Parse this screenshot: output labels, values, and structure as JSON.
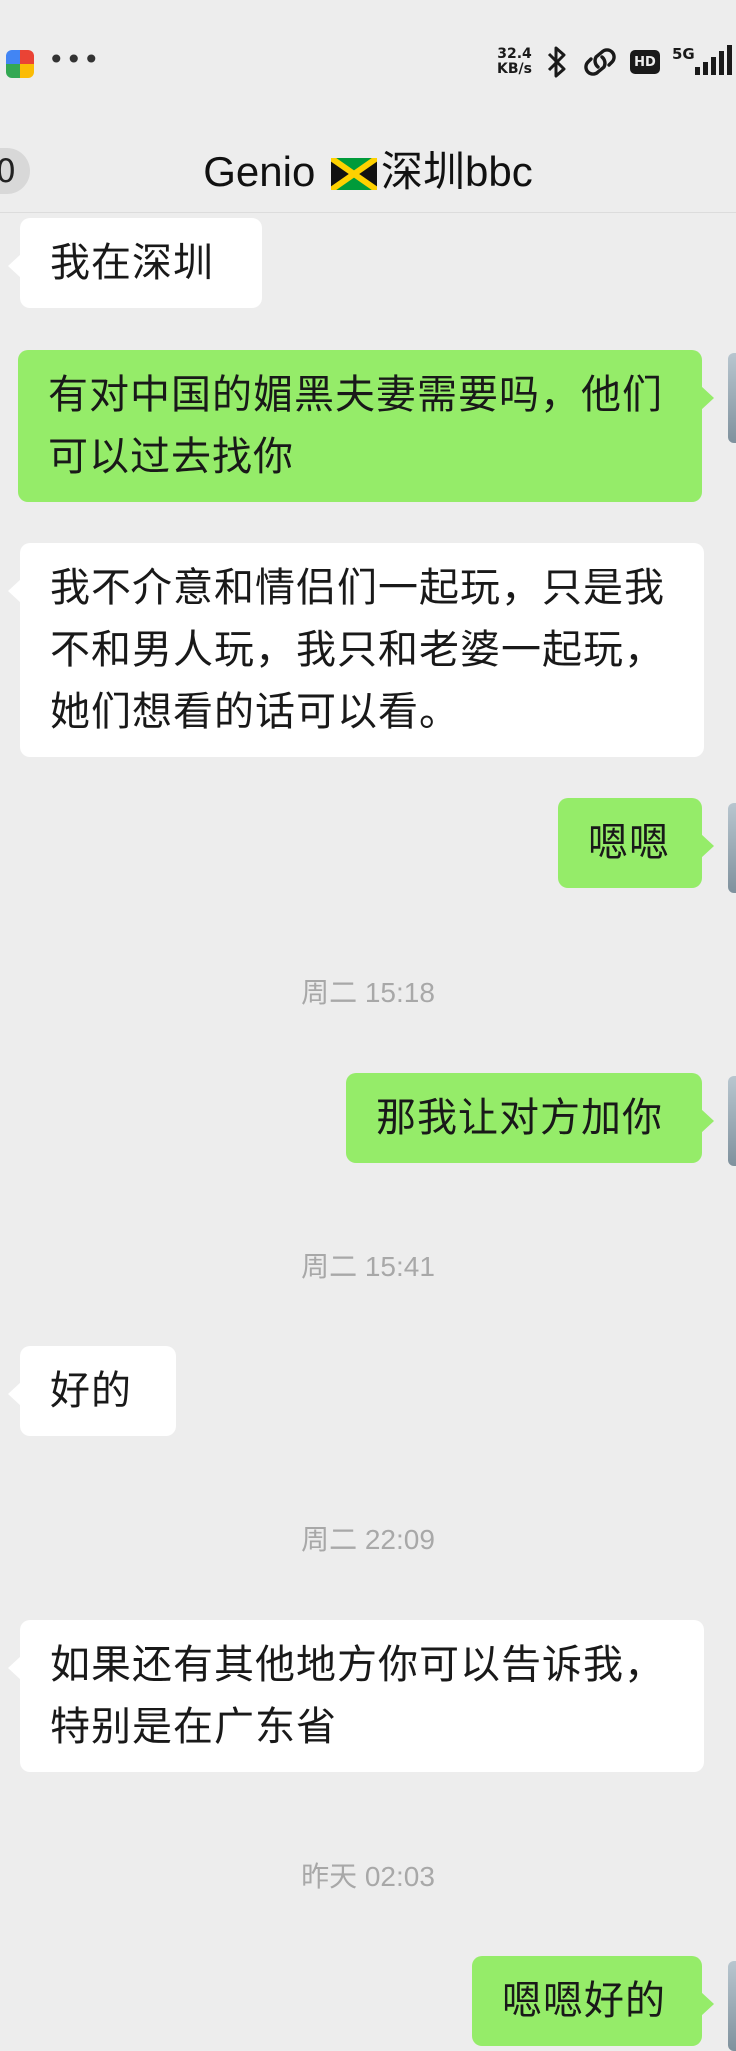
{
  "status_bar": {
    "net_speed_value": "32.4",
    "net_speed_unit": "KB/s",
    "hd_label": "HD",
    "network_label": "5G",
    "more_icon": "more-dots-icon",
    "icons": [
      "app-icon",
      "bluetooth-icon",
      "link-icon",
      "hd-icon",
      "signal-icon"
    ]
  },
  "header": {
    "unread_count": "0",
    "title_prefix": "Genio",
    "title_flag": "jamaica-flag-icon",
    "title_suffix": "深圳bbc"
  },
  "messages": [
    {
      "side": "in",
      "text": "我在深圳"
    },
    {
      "side": "out",
      "text": "有对中国的媚黑夫妻需要吗，他们可以过去找你"
    },
    {
      "side": "in",
      "text": "我不介意和情侣们一起玩，只是我不和男人玩，我只和老婆一起玩，她们想看的话可以看。"
    },
    {
      "side": "out",
      "text": "嗯嗯"
    },
    {
      "side": "time",
      "text": "周二 15:18"
    },
    {
      "side": "out",
      "text": "那我让对方加你"
    },
    {
      "side": "time",
      "text": "周二 15:41"
    },
    {
      "side": "in",
      "text": "好的"
    },
    {
      "side": "time",
      "text": "周二 22:09"
    },
    {
      "side": "in",
      "text": "如果还有其他地方你可以告诉我，特别是在广东省"
    },
    {
      "side": "time",
      "text": "昨天 02:03"
    },
    {
      "side": "out",
      "text": "嗯嗯好的"
    }
  ],
  "colors": {
    "background": "#ededed",
    "incoming_bubble": "#ffffff",
    "outgoing_bubble": "#95ec69",
    "timestamp_text": "#a8a8a8"
  }
}
